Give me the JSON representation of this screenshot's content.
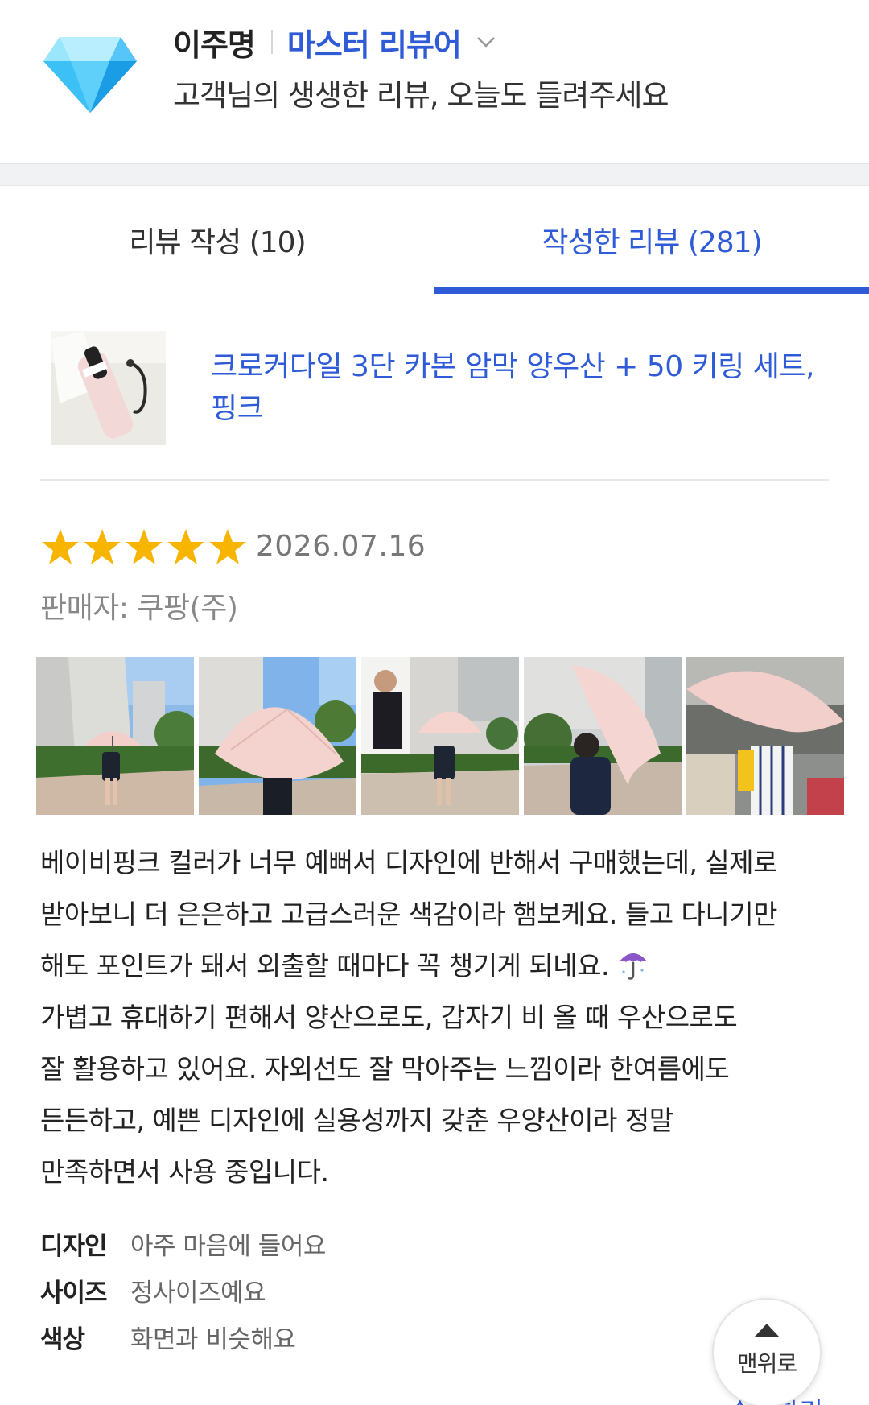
{
  "header": {
    "user_name": "이주명",
    "rank": "마스터 리뷰어",
    "subtitle": "고객님의 생생한 리뷰, 오늘도 들려주세요",
    "badge_icon": "diamond-icon",
    "dropdown_icon": "chevron-down-icon"
  },
  "tabs": [
    {
      "label": "리뷰 작성 (10)",
      "active": false
    },
    {
      "label": "작성한 리뷰 (281)",
      "active": true
    }
  ],
  "product": {
    "title_line1": "크로커다일 3단 카본 암막 양우산 + 50 키링 세트,",
    "title_line2": "핑크"
  },
  "review": {
    "rating": 5,
    "rating_max": 5,
    "date": "2026.07.16",
    "seller": "판매자: 쿠팡(주)",
    "photo_count": 5,
    "body_lines": [
      " 베이비핑크 컬러가 너무 예뻐서 디자인에 반해서 구매했는데, 실제로",
      "받아보니 더 은은하고 고급스러운 색감이라 햄보케요. 들고 다니기만",
      "해도 포인트가 돼서 외출할 때마다 꼭 챙기게 되네요.",
      "가볍고 휴대하기 편해서 양산으로도, 갑자기 비 올 때 우산으로도",
      "잘 활용하고 있어요. 자외선도 잘 막아주는 느낌이라 한여름에도",
      "든든하고, 예쁜 디자인에 실용성까지 갖춘 우양산이라 정말",
      "만족하면서 사용 중입니다."
    ],
    "emoji_icon": "umbrella-emoji-icon",
    "survey": [
      {
        "key": "디자인",
        "value": "아주 마음에 들어요"
      },
      {
        "key": "사이즈",
        "value": "정사이즈예요"
      },
      {
        "key": "색상",
        "value": "화면과 비슷해요"
      }
    ]
  },
  "floating": {
    "top_label": "맨위로",
    "edit_label": "수정하기"
  },
  "colors": {
    "accent": "#2f5bd6",
    "star": "#f7b500",
    "divider": "#e8e8ea"
  }
}
